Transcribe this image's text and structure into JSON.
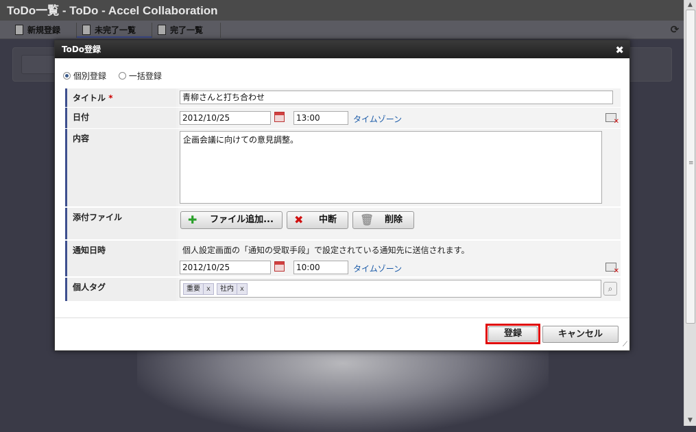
{
  "app": {
    "title": "ToDo一覧 - ToDo - Accel Collaboration",
    "toolbar": [
      {
        "label": "新規登録",
        "icon": "new-document-icon"
      },
      {
        "label": "未完了一覧",
        "icon": "document-icon"
      },
      {
        "label": "完了一覧",
        "icon": "checklist-icon"
      }
    ],
    "refresh_icon": "refresh-icon"
  },
  "modal": {
    "title": "ToDo登録",
    "close_glyph": "✖",
    "mode": {
      "options": [
        "個別登録",
        "一括登録"
      ],
      "selected": "個別登録"
    },
    "fields": {
      "title": {
        "label": "タイトル",
        "required_mark": "*",
        "value": "青柳さんと打ち合わせ"
      },
      "date": {
        "label": "日付",
        "date": "2012/10/25",
        "time": "13:00",
        "timezone_link": "タイムゾーン"
      },
      "content": {
        "label": "内容",
        "value": "企画会議に向けての意見調整。"
      },
      "attachments": {
        "label": "添付ファイル",
        "add_button": "ファイル追加...",
        "stop_button": "中断",
        "delete_button": "削除"
      },
      "notify": {
        "label": "通知日時",
        "note": "個人設定画面の「通知の受取手段」で設定されている通知先に送信されます。",
        "date": "2012/10/25",
        "time": "10:00",
        "timezone_link": "タイムゾーン"
      },
      "tags": {
        "label": "個人タグ",
        "items": [
          {
            "text": "重要",
            "remove": "x"
          },
          {
            "text": "社内",
            "remove": "x"
          }
        ]
      }
    },
    "buttons": {
      "submit": "登録",
      "cancel": "キャンセル"
    }
  },
  "colors": {
    "accent": "#3d4f8e",
    "highlight": "#e00000",
    "link": "#1a5aa8"
  }
}
